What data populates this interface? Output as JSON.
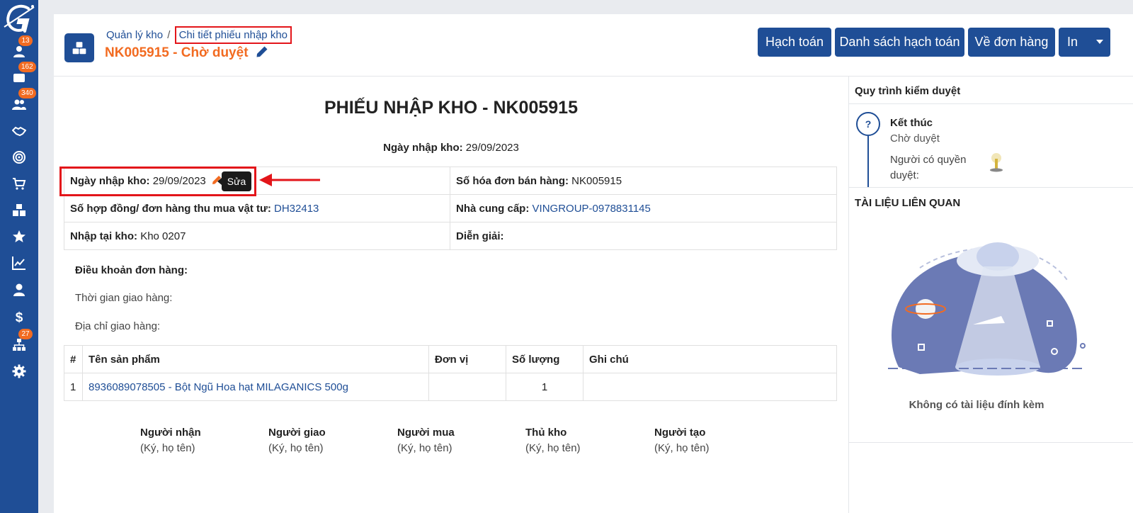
{
  "sidebar": {
    "items": [
      {
        "name": "contacts",
        "badge": "13"
      },
      {
        "name": "messages",
        "badge": "162"
      },
      {
        "name": "users",
        "badge": "340"
      },
      {
        "name": "handshake",
        "badge": ""
      },
      {
        "name": "target",
        "badge": ""
      },
      {
        "name": "cart",
        "badge": ""
      },
      {
        "name": "boxes",
        "badge": ""
      },
      {
        "name": "star",
        "badge": ""
      },
      {
        "name": "chart",
        "badge": ""
      },
      {
        "name": "person",
        "badge": ""
      },
      {
        "name": "dollar",
        "badge": ""
      },
      {
        "name": "org",
        "badge": "27"
      },
      {
        "name": "settings",
        "badge": ""
      }
    ]
  },
  "header": {
    "breadcrumb_parent": "Quản lý kho",
    "breadcrumb_sep": "/",
    "breadcrumb_current": "Chi tiết phiếu nhập kho",
    "title": "NK005915 - Chờ duyệt",
    "buttons": {
      "accounting": "Hạch toán",
      "accounting_list": "Danh sách hạch toán",
      "to_order": "Về đơn hàng",
      "print": "In"
    }
  },
  "document": {
    "heading": "PHIẾU NHẬP KHO - NK005915",
    "date_label": "Ngày nhập kho:",
    "date_value": "29/09/2023",
    "info": {
      "import_date_label": "Ngày nhập kho:",
      "import_date_value": "29/09/2023",
      "invoice_label": "Số hóa đơn bán hàng:",
      "invoice_value": "NK005915",
      "contract_label": "Số hợp đồng/ đơn hàng thu mua vật tư:",
      "contract_value": "DH32413",
      "supplier_label": "Nhà cung cấp:",
      "supplier_value": "VINGROUP-0978831145",
      "warehouse_label": "Nhập tại kho:",
      "warehouse_value": "Kho 0207",
      "description_label": "Diễn giải:",
      "description_value": ""
    },
    "edit_tooltip": "Sửa",
    "terms_title": "Điều khoản đơn hàng:",
    "delivery_time_label": "Thời gian giao hàng:",
    "delivery_address_label": "Địa chỉ giao hàng:",
    "product_table": {
      "headers": [
        "#",
        "Tên sản phẩm",
        "Đơn vị",
        "Số lượng",
        "Ghi chú"
      ],
      "rows": [
        {
          "index": "1",
          "product": "8936089078505 - Bột Ngũ Hoa hạt MILAGANICS 500g",
          "unit": "",
          "quantity": "1",
          "note": ""
        }
      ]
    },
    "signatures": [
      {
        "role": "Người nhận",
        "note": "(Ký, họ tên)"
      },
      {
        "role": "Người giao",
        "note": "(Ký, họ tên)"
      },
      {
        "role": "Người mua",
        "note": "(Ký, họ tên)"
      },
      {
        "role": "Thủ kho",
        "note": "(Ký, họ tên)"
      },
      {
        "role": "Người tạo",
        "note": "(Ký, họ tên)"
      }
    ]
  },
  "right_panel": {
    "approval_title": "Quy trình kiểm duyệt",
    "step_icon": "?",
    "step_title": "Kết thúc",
    "step_status": "Chờ duyệt",
    "approver_label_1": "Người có quyền",
    "approver_label_2": "duyệt:",
    "related_docs_title": "TÀI LIỆU LIÊN QUAN",
    "no_docs": "Không có tài liệu đính kèm"
  },
  "colors": {
    "brand": "#1f4e96",
    "accent": "#f26b21",
    "highlight": "#e3151a"
  }
}
